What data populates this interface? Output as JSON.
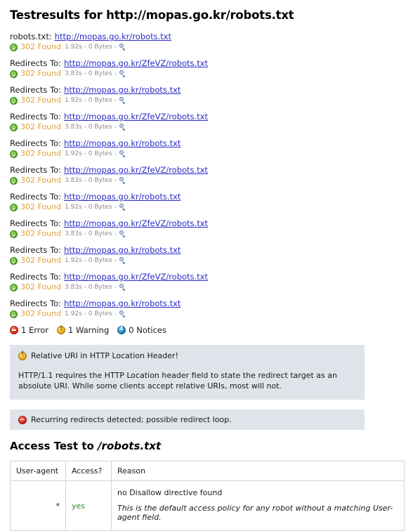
{
  "page": {
    "title": "Testresults for http://mopas.go.kr/robots.txt"
  },
  "chain": {
    "entries": [
      {
        "label": "robots.txt:",
        "url": "http://mopas.go.kr/robots.txt",
        "status": "302 Found",
        "meta": "1.92s - 0 Bytes -"
      },
      {
        "label": "Redirects To:",
        "url": "http://mopas.go.kr/ZfeVZ/robots.txt",
        "status": "302 Found",
        "meta": "3.83s - 0 Bytes -"
      },
      {
        "label": "Redirects To:",
        "url": "http://mopas.go.kr/robots.txt",
        "status": "302 Found",
        "meta": "1.92s - 0 Bytes -"
      },
      {
        "label": "Redirects To:",
        "url": "http://mopas.go.kr/ZfeVZ/robots.txt",
        "status": "302 Found",
        "meta": "3.83s - 0 Bytes -"
      },
      {
        "label": "Redirects To:",
        "url": "http://mopas.go.kr/robots.txt",
        "status": "302 Found",
        "meta": "1.92s - 0 Bytes -"
      },
      {
        "label": "Redirects To:",
        "url": "http://mopas.go.kr/ZfeVZ/robots.txt",
        "status": "302 Found",
        "meta": "3.83s - 0 Bytes -"
      },
      {
        "label": "Redirects To:",
        "url": "http://mopas.go.kr/robots.txt",
        "status": "302 Found",
        "meta": "1.92s - 0 Bytes -"
      },
      {
        "label": "Redirects To:",
        "url": "http://mopas.go.kr/ZfeVZ/robots.txt",
        "status": "302 Found",
        "meta": "3.83s - 0 Bytes -"
      },
      {
        "label": "Redirects To:",
        "url": "http://mopas.go.kr/robots.txt",
        "status": "302 Found",
        "meta": "1.92s - 0 Bytes -"
      },
      {
        "label": "Redirects To:",
        "url": "http://mopas.go.kr/ZfeVZ/robots.txt",
        "status": "302 Found",
        "meta": "3.83s - 0 Bytes -"
      },
      {
        "label": "Redirects To:",
        "url": "http://mopas.go.kr/robots.txt",
        "status": "302 Found",
        "meta": "1.92s - 0 Bytes -"
      }
    ],
    "icons": {
      "status": "check-circle-icon",
      "detail": "magnifier-icon"
    }
  },
  "summary": {
    "errors": "1 Error",
    "warnings": "1 Warning",
    "notices": "0 Notices"
  },
  "messages": [
    {
      "severity": "warning",
      "heading": "Relative URI in HTTP Location Header!",
      "body": "HTTP/1.1 requires the HTTP Location header field to state the redirect target as an absolute URI. While some clients accept relative URIs, most will not."
    },
    {
      "severity": "error",
      "heading": "Recurring redirects detected; possible redirect loop.",
      "body": ""
    }
  ],
  "access_test": {
    "title_prefix": "Access Test to ",
    "title_path": "/robots.txt",
    "columns": [
      "User-agent",
      "Access?",
      "Reason"
    ],
    "rows": [
      {
        "user_agent": "*",
        "access": "yes",
        "reason_main": "no Disallow directive found",
        "reason_note": "This is the default access policy for any robot without a matching User-agent field."
      }
    ]
  },
  "colors": {
    "link": "#2b2bc8",
    "status": "#e0a33a",
    "meta": "#8b8b8b",
    "msgbox_bg": "#dfe3ea",
    "access_yes": "#2e8b2e",
    "table_border": "#d3d3d3"
  }
}
